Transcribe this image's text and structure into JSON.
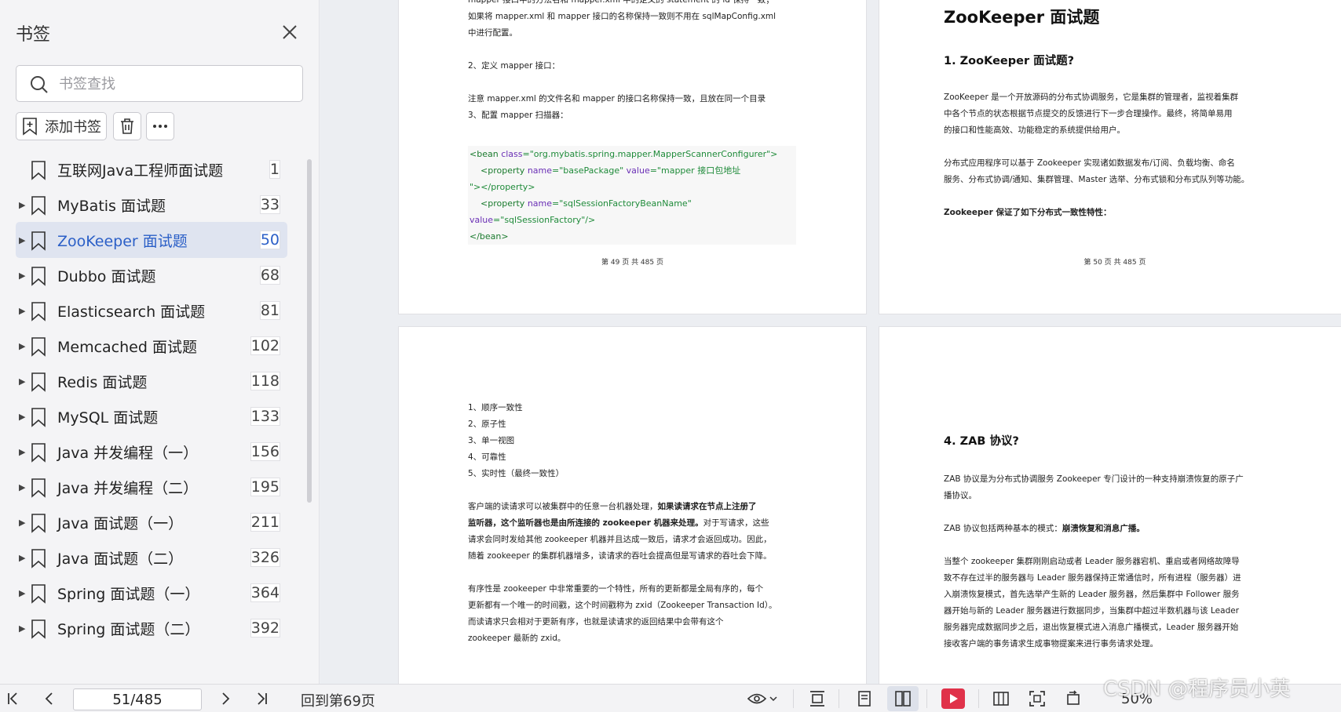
{
  "sidebar": {
    "title": "书签",
    "search_placeholder": "书签查找",
    "add_label": "添加书签",
    "items": [
      {
        "label": "互联网Java工程师面试题",
        "page": "1",
        "arrow": ""
      },
      {
        "label": "MyBatis 面试题",
        "page": "33",
        "arrow": "▶"
      },
      {
        "label": "ZooKeeper 面试题",
        "page": "50",
        "arrow": "▶"
      },
      {
        "label": "Dubbo 面试题",
        "page": "68",
        "arrow": "▶"
      },
      {
        "label": "Elasticsearch 面试题",
        "page": "81",
        "arrow": "▶"
      },
      {
        "label": "Memcached 面试题",
        "page": "102",
        "arrow": "▶"
      },
      {
        "label": "Redis 面试题",
        "page": "118",
        "arrow": "▶"
      },
      {
        "label": "MySQL 面试题",
        "page": "133",
        "arrow": "▶"
      },
      {
        "label": "Java 并发编程（一）",
        "page": "156",
        "arrow": "▶"
      },
      {
        "label": "Java 并发编程（二）",
        "page": "195",
        "arrow": "▶"
      },
      {
        "label": "Java 面试题（一）",
        "page": "211",
        "arrow": "▶"
      },
      {
        "label": "Java 面试题（二）",
        "page": "326",
        "arrow": "▶"
      },
      {
        "label": "Spring 面试题（一）",
        "page": "364",
        "arrow": "▶"
      },
      {
        "label": "Spring 面试题（二）",
        "page": "392",
        "arrow": "▶"
      }
    ]
  },
  "pages": {
    "p49": {
      "line1": "mapper 接口中的方法名和 mapper.xml 中的定义的 statement 的 id 保持一致；",
      "line2": "如果将 mapper.xml 和 mapper 接口的名称保持一致则不用在 sqlMapConfig.xml",
      "line3": "中进行配置。",
      "step2": "2、定义 mapper 接口：",
      "note": "注意 mapper.xml 的文件名和 mapper 的接口名称保持一致，且放在同一个目录",
      "step3": "3、配置 mapper 扫描器：",
      "code": {
        "l1_tag": "<bean ",
        "l1_attr": "class",
        "l1_val": "=\"org.mybatis.spring.mapper.MapperScannerConfigurer\">",
        "l2_tag": "<property ",
        "l2_attr1": "name",
        "l2_val1": "=\"basePackage\" ",
        "l2_attr2": "value",
        "l2_val2": "=\"mapper 接口包地址",
        "l3": "\"></property>",
        "l4_tag": "<property ",
        "l4_attr": "name",
        "l4_val": "=\"sqlSessionFactoryBeanName\"",
        "l5_attr": "value",
        "l5_val": "=\"sqlSessionFactory\"/>",
        "l6": "</bean>"
      },
      "footer": "第 49 页 共 485 页"
    },
    "p50": {
      "title": "ZooKeeper 面试题",
      "q1": "1. ZooKeeper 面试题?",
      "para1_l1": "ZooKeeper 是一个开放源码的分布式协调服务，它是集群的管理者，监视着集群",
      "para1_l2": "中各个节点的状态根据节点提交的反馈进行下一步合理操作。最终，将简单易用",
      "para1_l3": "的接口和性能高效、功能稳定的系统提供给用户。",
      "para2_l1": "分布式应用程序可以基于 Zookeeper 实现诸如数据发布/订阅、负载均衡、命名",
      "para2_l2": "服务、分布式协调/通知、集群管理、Master 选举、分布式锁和分布式队列等功能。",
      "para3": "Zookeeper 保证了如下分布式一致性特性：",
      "footer": "第 50 页 共 485 页"
    },
    "p51": {
      "li1": "1、顺序一致性",
      "li2": "2、原子性",
      "li3": "3、单一视图",
      "li4": "4、可靠性",
      "li5": "5、实时性（最终一致性）",
      "pa_l1a": "客户端的读请求可以被集群中的任意一台机器处理，",
      "pa_l1b": "如果读请求在节点上注册了",
      "pa_l2": "监听器，这个监听器也是由所连接的 zookeeper 机器来处理。",
      "pa_l2b": "对于写请求，这些",
      "pa_l3": "请求会同时发给其他 zookeeper 机器并且达成一致后，请求才会返回成功。因此，",
      "pa_l4": "随着 zookeeper 的集群机器增多，读请求的吞吐会提高但是写请求的吞吐会下降。",
      "pb_l1": "有序性是 zookeeper 中非常重要的一个特性，所有的更新都是全局有序的，每个",
      "pb_l2": "更新都有一个唯一的时间戳，这个时间戳称为 zxid（Zookeeper Transaction Id）。",
      "pb_l3": "而读请求只会相对于更新有序，也就是读请求的返回结果中会带有这个",
      "pb_l4": "zookeeper 最新的 zxid。"
    },
    "p52": {
      "q4": "4. ZAB 协议?",
      "pa_l1": "ZAB 协议是为分布式协调服务 Zookeeper 专门设计的一种支持崩溃恢复的原子广",
      "pa_l2": "播协议。",
      "pb_a": "ZAB 协议包括两种基本的模式：",
      "pb_b": "崩溃恢复和消息广播。",
      "pc_l1": "当整个 zookeeper 集群刚刚启动或者 Leader 服务器宕机、重启或者网络故障导",
      "pc_l2": "致不存在过半的服务器与 Leader 服务器保持正常通信时，所有进程（服务器）进",
      "pc_l3": "入崩溃恢复模式，首先选举产生新的 Leader 服务器，然后集群中 Follower 服务",
      "pc_l4": "器开始与新的 Leader 服务器进行数据同步，当集群中超过半数机器与该 Leader",
      "pc_l5": "服务器完成数据同步之后，退出恢复模式进入消息广播模式，Leader 服务器开始",
      "pc_l6": "接收客户端的事务请求生成事物提案来进行事务请求处理。"
    }
  },
  "toolbar": {
    "page_value": "51/485",
    "goto_label": "回到第69页",
    "zoom": "50%"
  },
  "watermark": "CSDN @程序员小英",
  "colors": {
    "accent": "#2b5fc7",
    "active_bg": "#dfe4f0",
    "play_red": "#e0324a"
  }
}
